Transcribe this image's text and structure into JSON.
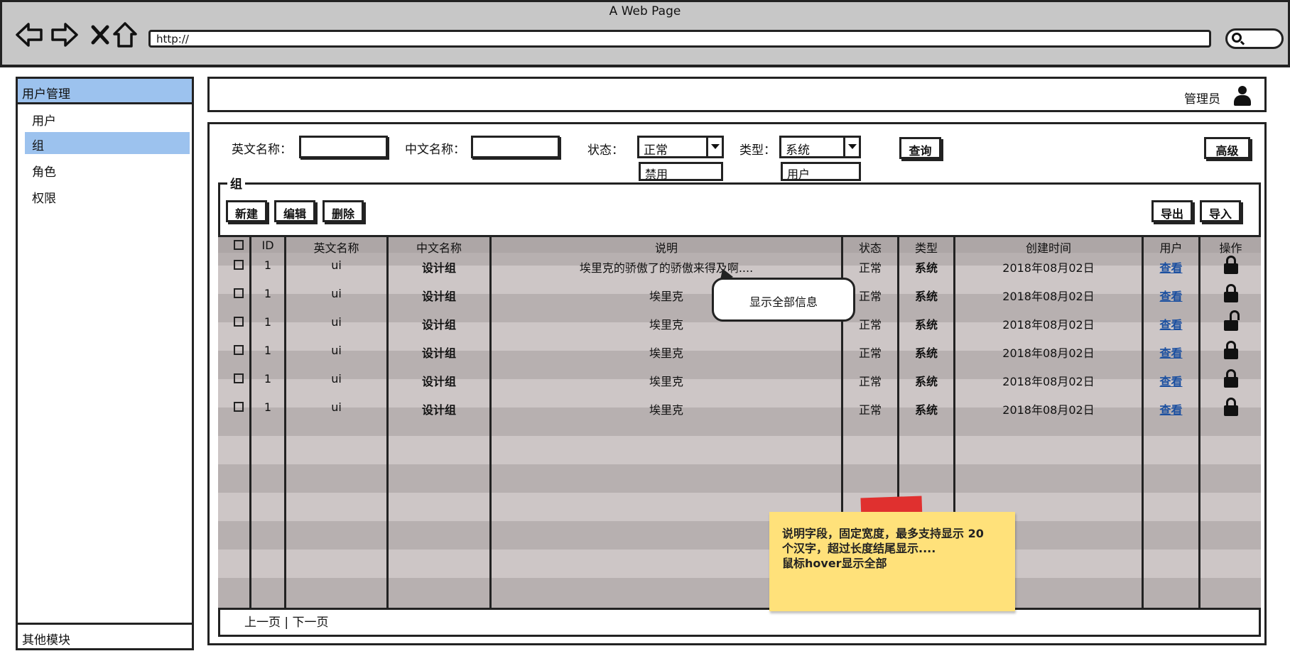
{
  "browser": {
    "title": "A Web Page",
    "url": "http://",
    "icons": [
      "back-icon",
      "forward-icon",
      "close-icon",
      "home-icon",
      "search-icon"
    ]
  },
  "sidebar": {
    "header": "用户管理",
    "items": [
      {
        "label": "用户"
      },
      {
        "label": "组"
      },
      {
        "label": "角色"
      },
      {
        "label": "权限"
      }
    ],
    "active_index": 1,
    "footer": "其他模块"
  },
  "header": {
    "user_label": "管理员"
  },
  "filters": {
    "en_name_label": "英文名称：",
    "en_name_value": "",
    "cn_name_label": "中文名称：",
    "cn_name_value": "",
    "status_label": "状态：",
    "status_value": "正常",
    "status_option": "禁用",
    "type_label": "类型：",
    "type_value": "系统",
    "type_option": "用户",
    "query_button": "查询",
    "advanced_button": "高级"
  },
  "group": {
    "legend": "组",
    "actions": {
      "new": "新建",
      "edit": "编辑",
      "delete": "删除",
      "export": "导出",
      "import": "导入"
    }
  },
  "table": {
    "headers": [
      "ID",
      "英文名称",
      "中文名称",
      "说明",
      "状态",
      "类型",
      "创建时间",
      "用户",
      "操作"
    ],
    "rows": [
      {
        "id": "1",
        "en": "ui",
        "cn": "设计组",
        "desc": "埃里克的骄傲了的骄傲来得及啊....",
        "status": "正常",
        "type": "系统",
        "created": "2018年08月02日",
        "user": "查看",
        "locked": true
      },
      {
        "id": "1",
        "en": "ui",
        "cn": "设计组",
        "desc": "埃里克",
        "status": "正常",
        "type": "系统",
        "created": "2018年08月02日",
        "user": "查看",
        "locked": true
      },
      {
        "id": "1",
        "en": "ui",
        "cn": "设计组",
        "desc": "埃里克",
        "status": "正常",
        "type": "系统",
        "created": "2018年08月02日",
        "user": "查看",
        "locked": false
      },
      {
        "id": "1",
        "en": "ui",
        "cn": "设计组",
        "desc": "埃里克",
        "status": "正常",
        "type": "系统",
        "created": "2018年08月02日",
        "user": "查看",
        "locked": true
      },
      {
        "id": "1",
        "en": "ui",
        "cn": "设计组",
        "desc": "埃里克",
        "status": "正常",
        "type": "系统",
        "created": "2018年08月02日",
        "user": "查看",
        "locked": true
      },
      {
        "id": "1",
        "en": "ui",
        "cn": "设计组",
        "desc": "埃里克",
        "status": "正常",
        "type": "系统",
        "created": "2018年08月02日",
        "user": "查看",
        "locked": true
      }
    ]
  },
  "tooltip": "显示全部信息",
  "pager": "上一页 | 下一页",
  "note": {
    "line1": "说明字段，固定宽度，最多支持显示 20",
    "line2": "个汉字，超过长度结尾显示....",
    "line3": "鼠标hover显示全部"
  },
  "colors": {
    "chrome": "#c7c7c7",
    "highlight": "#9cc2ee",
    "table_dark": "#b7b0b0",
    "table_light": "#cdc6c6",
    "note": "#ffe17a",
    "tape": "#e0302f",
    "link": "#1a4fa0"
  }
}
